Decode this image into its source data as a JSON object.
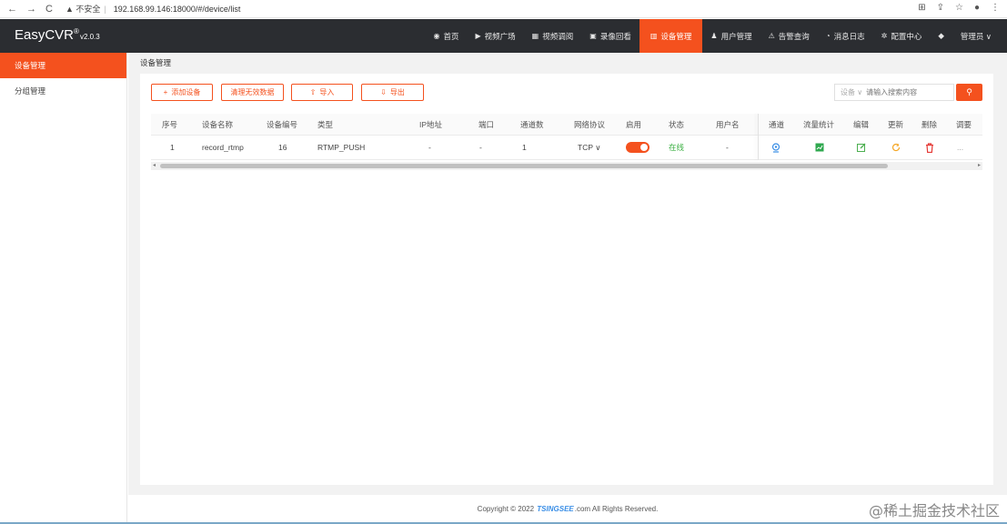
{
  "browser": {
    "nav_back": "←",
    "nav_forward": "→",
    "nav_reload": "C",
    "security": "▲ 不安全",
    "url": "192.168.99.146:18000/#/device/list"
  },
  "header": {
    "brand": "EasyCVR",
    "brand_mark": "®",
    "version": "v2.0.3",
    "menu": [
      {
        "label": "首页",
        "icon": "dashboard-icon",
        "glyph": "◉"
      },
      {
        "label": "视频广场",
        "icon": "play-icon",
        "glyph": "▶"
      },
      {
        "label": "视频调阅",
        "icon": "grid-icon",
        "glyph": "▦"
      },
      {
        "label": "录像回看",
        "icon": "camera-icon",
        "glyph": "▣"
      },
      {
        "label": "设备管理",
        "icon": "device-icon",
        "glyph": "▥"
      },
      {
        "label": "用户管理",
        "icon": "user-icon",
        "glyph": "♟"
      },
      {
        "label": "告警查询",
        "icon": "alarm-icon",
        "glyph": "⚠"
      },
      {
        "label": "消息日志",
        "icon": "bell-icon",
        "glyph": "◔"
      },
      {
        "label": "配置中心",
        "icon": "gear-icon",
        "glyph": "✲"
      }
    ],
    "bell_glyph": "◆",
    "user_label": "管理员 ∨"
  },
  "sidebar": {
    "items": [
      {
        "label": "设备管理"
      },
      {
        "label": "分组管理"
      }
    ]
  },
  "main": {
    "breadcrumb": "设备管理",
    "buttons": {
      "add": "添加设备",
      "clear": "清理无效数据",
      "import": "导入",
      "export": "导出"
    },
    "search": {
      "field_select": "设备 ∨",
      "placeholder": "请输入搜索内容",
      "button_glyph": "⚲"
    },
    "table": {
      "headers": [
        "序号",
        "设备名称",
        "设备编号",
        "类型",
        "IP地址",
        "端口",
        "通道数",
        "网络协议",
        "启用",
        "状态",
        "用户名",
        "通道",
        "流量统计",
        "编辑",
        "更新",
        "删除",
        "调要"
      ],
      "rows": [
        {
          "index": "1",
          "name": "record_rtmp",
          "number": "16",
          "type": "RTMP_PUSH",
          "ip": "-",
          "port": "-",
          "channels": "1",
          "protocol": "TCP ∨",
          "enabled": true,
          "status": "在线",
          "username": "-",
          "more": "..."
        }
      ]
    }
  },
  "footer": {
    "copyright_pre": "Copyright © 2022",
    "copyright_logo": "TSINGSEE",
    "copyright_post": ".com All Rights Reserved."
  },
  "watermark": "@稀土掘金技术社区",
  "colors": {
    "accent": "#f4511e",
    "topbar": "#2b2d31",
    "online": "#3cb043"
  }
}
